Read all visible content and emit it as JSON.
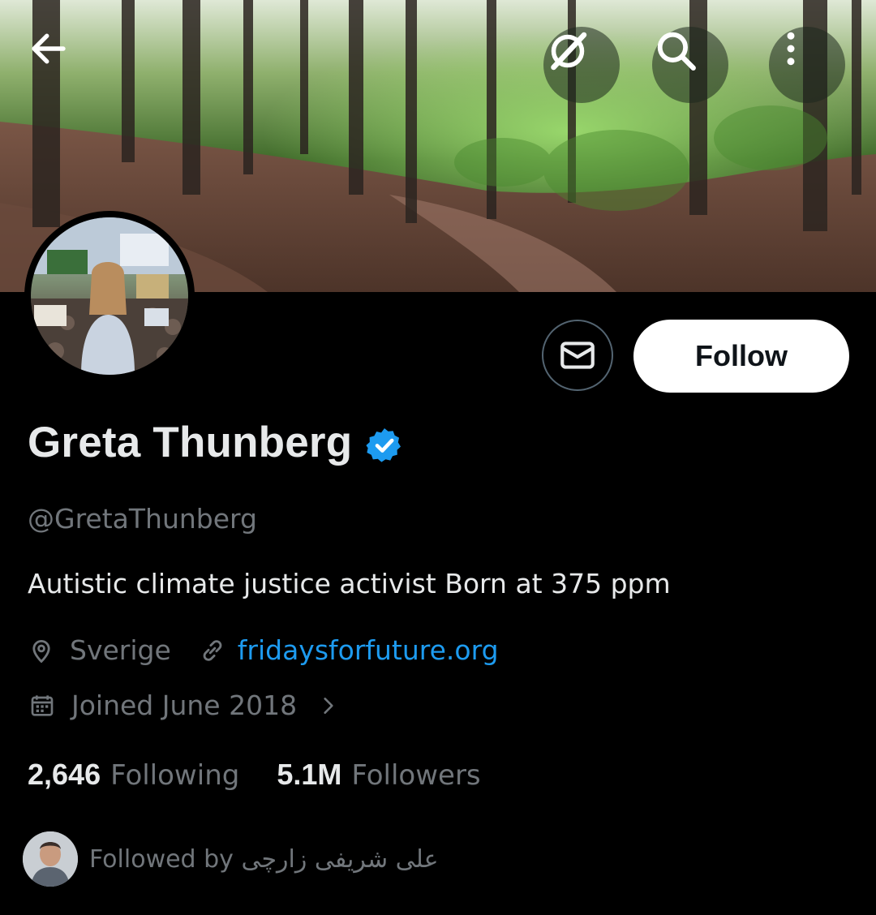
{
  "header": {
    "back_icon": "arrow-left-icon",
    "grok_icon": "grok-icon",
    "search_icon": "search-icon",
    "more_icon": "more-vertical-icon"
  },
  "profile": {
    "display_name": "Greta Thunberg",
    "verified": true,
    "handle": "@GretaThunberg",
    "bio": "Autistic climate justice activist Born at 375 ppm",
    "location": "Sverige",
    "website": "fridaysforfuture.org",
    "joined": "Joined June 2018"
  },
  "actions": {
    "follow_label": "Follow",
    "message_icon": "envelope-icon"
  },
  "stats": {
    "following_count": "2,646",
    "following_label": "Following",
    "followers_count": "5.1M",
    "followers_label": "Followers"
  },
  "followed_by": {
    "text": "Followed by علی شریفی زارچی"
  },
  "colors": {
    "background": "#000000",
    "primary_text": "#e7e9ea",
    "secondary_text": "#71767b",
    "link": "#1d9bf0",
    "verified": "#1d9bf0"
  }
}
